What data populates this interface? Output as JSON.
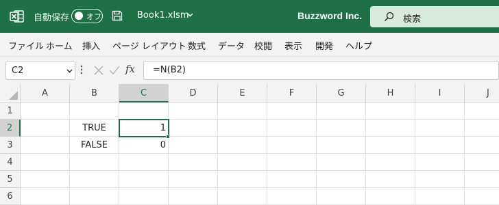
{
  "titlebar": {
    "autosave_label": "自動保存",
    "autosave_state": "オフ",
    "filename": "Book1.xlsm",
    "company": "Buzzword Inc.",
    "search_label": "検索"
  },
  "menu": [
    "ファイル",
    "ホーム",
    "挿入",
    "ページ レイアウト",
    "数式",
    "データ",
    "校閲",
    "表示",
    "開発",
    "ヘルプ"
  ],
  "formula_bar": {
    "name_box": "C2",
    "fx_label": "fx",
    "formula": "=N(B2)"
  },
  "grid": {
    "columns": [
      "A",
      "B",
      "C",
      "D",
      "E",
      "F",
      "G",
      "H",
      "I",
      "J"
    ],
    "rows": [
      "1",
      "2",
      "3",
      "4",
      "5",
      "6"
    ],
    "active_cell": "C2",
    "cells": {
      "B2": "TRUE",
      "C2": "1",
      "B3": "FALSE",
      "C3": "0"
    }
  },
  "colors": {
    "accent": "#1e7145",
    "search_bg": "#d6ebdc",
    "menu_bg": "#f3f3f3"
  },
  "icons": [
    "excel-icon",
    "save-icon",
    "chevron-down-icon",
    "search-icon",
    "more-dots-icon",
    "cancel-icon",
    "enter-check-icon",
    "fx-icon"
  ]
}
